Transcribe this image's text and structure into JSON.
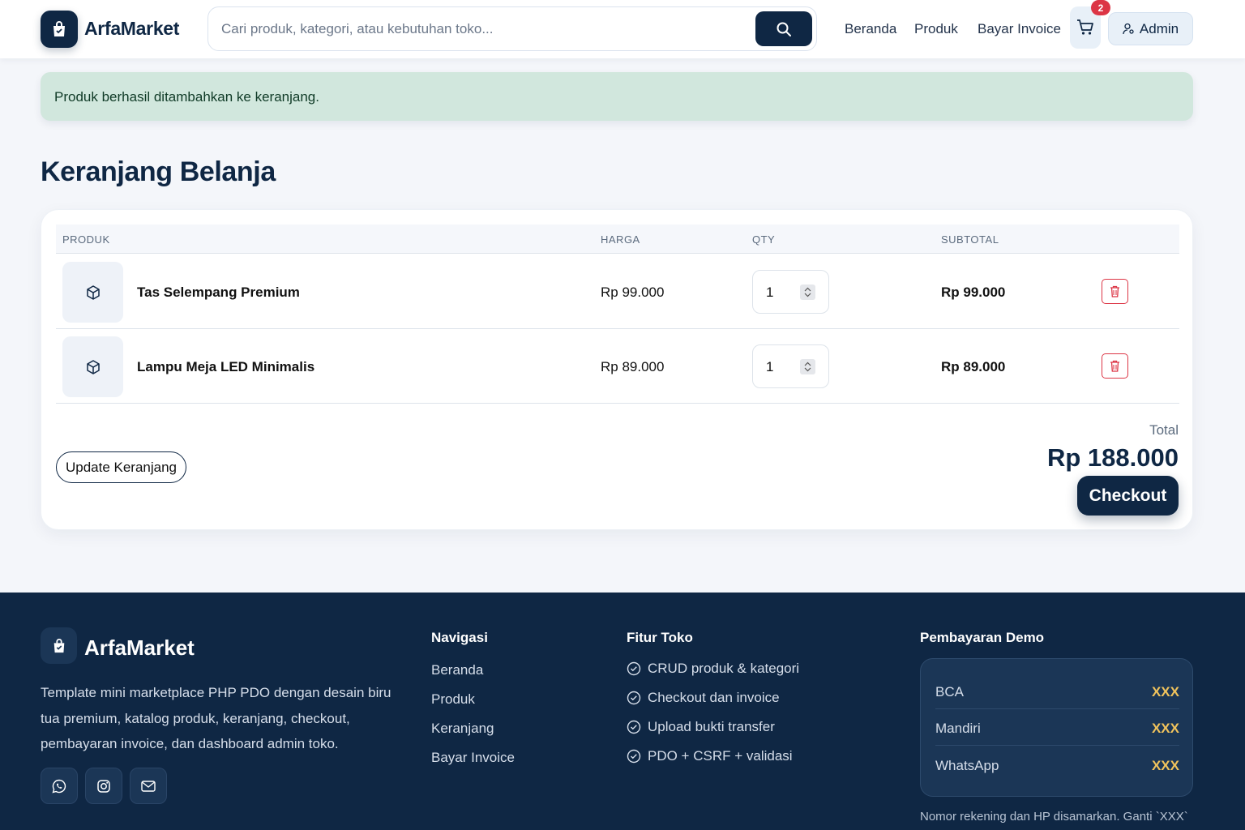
{
  "header": {
    "brand": "ArfaMarket",
    "search_placeholder": "Cari produk, kategori, atau kebutuhan toko...",
    "nav": [
      "Beranda",
      "Produk",
      "Bayar Invoice"
    ],
    "cart_count": "2",
    "admin_label": "Admin"
  },
  "alert": {
    "message": "Produk berhasil ditambahkan ke keranjang."
  },
  "page_title": "Keranjang Belanja",
  "cart": {
    "columns": [
      "PRODUK",
      "HARGA",
      "QTY",
      "SUBTOTAL"
    ],
    "items": [
      {
        "name": "Tas Selempang Premium",
        "price": "Rp 99.000",
        "qty": "1",
        "subtotal": "Rp 99.000"
      },
      {
        "name": "Lampu Meja LED Minimalis",
        "price": "Rp 89.000",
        "qty": "1",
        "subtotal": "Rp 89.000"
      }
    ],
    "update_label": "Update Keranjang",
    "total_label": "Total",
    "total_value": "Rp 188.000",
    "checkout_label": "Checkout"
  },
  "footer": {
    "brand": "ArfaMarket",
    "description": "Template mini marketplace PHP PDO dengan desain biru tua premium, katalog produk, keranjang, checkout, pembayaran invoice, dan dashboard admin toko.",
    "social_icons": [
      "whatsapp-icon",
      "instagram-icon",
      "mail-icon"
    ],
    "nav_heading": "Navigasi",
    "nav_links": [
      "Beranda",
      "Produk",
      "Keranjang",
      "Bayar Invoice"
    ],
    "features_heading": "Fitur Toko",
    "features": [
      "CRUD produk & kategori",
      "Checkout dan invoice",
      "Upload bukti transfer",
      "PDO + CSRF + validasi"
    ],
    "payment_heading": "Pembayaran Demo",
    "payments": [
      {
        "name": "BCA",
        "value": "XXX"
      },
      {
        "name": "Mandiri",
        "value": "XXX"
      },
      {
        "name": "WhatsApp",
        "value": "XXX"
      }
    ],
    "payment_note": "Nomor rekening dan HP disamarkan. Ganti `XXX`"
  },
  "colors": {
    "primary": "#0f2744",
    "danger": "#dc3545",
    "success_bg": "#d1e7dd",
    "accent_gold": "#f0c35c"
  }
}
